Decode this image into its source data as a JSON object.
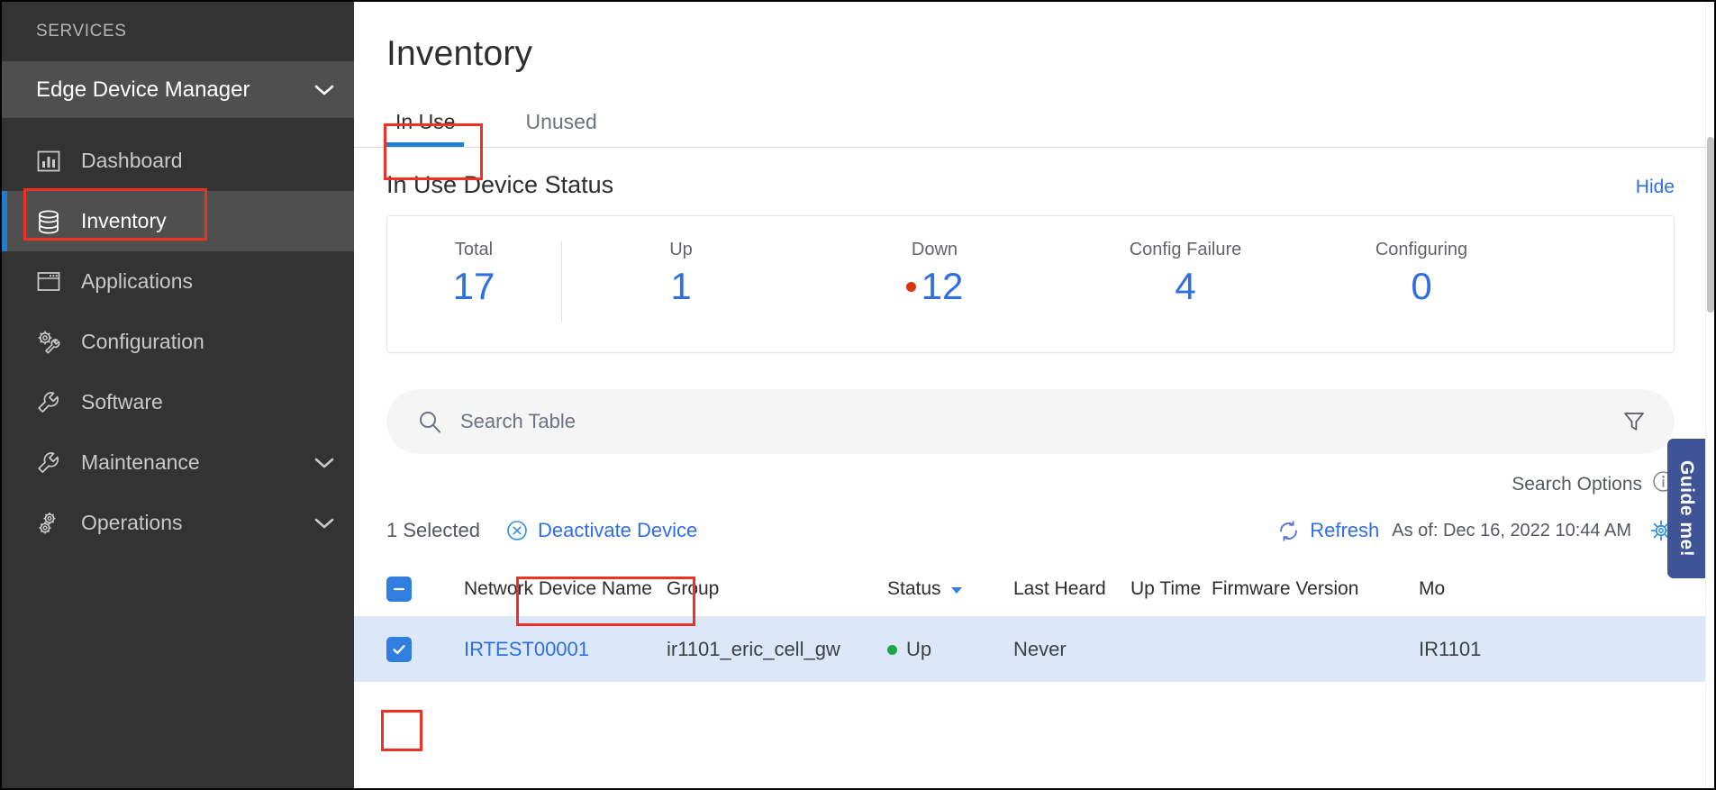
{
  "sidebar": {
    "services_label": "SERVICES",
    "service_name": "Edge Device Manager",
    "items": [
      {
        "label": "Dashboard",
        "icon": "chart-bars-icon",
        "active": false,
        "chevron": false
      },
      {
        "label": "Inventory",
        "icon": "database-icon",
        "active": true,
        "chevron": false
      },
      {
        "label": "Applications",
        "icon": "window-icon",
        "active": false,
        "chevron": false
      },
      {
        "label": "Configuration",
        "icon": "gear-wrench-icon",
        "active": false,
        "chevron": false
      },
      {
        "label": "Software",
        "icon": "wrench-icon",
        "active": false,
        "chevron": false
      },
      {
        "label": "Maintenance",
        "icon": "wrench-icon",
        "active": false,
        "chevron": true
      },
      {
        "label": "Operations",
        "icon": "gears-icon",
        "active": false,
        "chevron": true
      }
    ]
  },
  "main": {
    "page_title": "Inventory",
    "tabs": [
      {
        "label": "In Use",
        "active": true
      },
      {
        "label": "Unused",
        "active": false
      }
    ],
    "status": {
      "heading": "In Use Device Status",
      "hide_label": "Hide",
      "stats": [
        {
          "label": "Total",
          "value": "17",
          "dot": false
        },
        {
          "label": "Up",
          "value": "1",
          "dot": false
        },
        {
          "label": "Down",
          "value": "12",
          "dot": true
        },
        {
          "label": "Config Failure",
          "value": "4",
          "dot": false
        },
        {
          "label": "Configuring",
          "value": "0",
          "dot": false
        }
      ],
      "down_dot_color": "#d6380b"
    },
    "search": {
      "placeholder": "Search Table",
      "value": "",
      "icon": "search-icon",
      "filter_icon": "filter-funnel-icon"
    },
    "search_options_label": "Search Options",
    "toolbar": {
      "selected_count": "1 Selected",
      "deactivate_label": "Deactivate Device",
      "refresh_label": "Refresh",
      "as_of": "As of: Dec 16, 2022 10:44 AM"
    },
    "table": {
      "columns": [
        "Network Device Name",
        "Group",
        "Status",
        "Last Heard",
        "Up Time",
        "Firmware Version",
        "Mo"
      ],
      "sorted_column": "Status",
      "rows": [
        {
          "selected": true,
          "name": "IRTEST00001",
          "group": "ir1101_eric_cell_gw",
          "status": "Up",
          "last_heard": "Never",
          "up_time": "",
          "firmware": "",
          "model": "IR1101"
        }
      ]
    },
    "guide_me_label": "Guide me!"
  },
  "colors": {
    "accent_blue": "#2f6fe0",
    "sidebar_bg": "#333333",
    "sidebar_active": "#4f4f4f",
    "annotation_red": "#ee3124",
    "status_up_green": "#1aa845",
    "status_down_red": "#d6380b",
    "row_selected_bg": "#dce8f8",
    "guide_me_bg": "#3f5496"
  }
}
